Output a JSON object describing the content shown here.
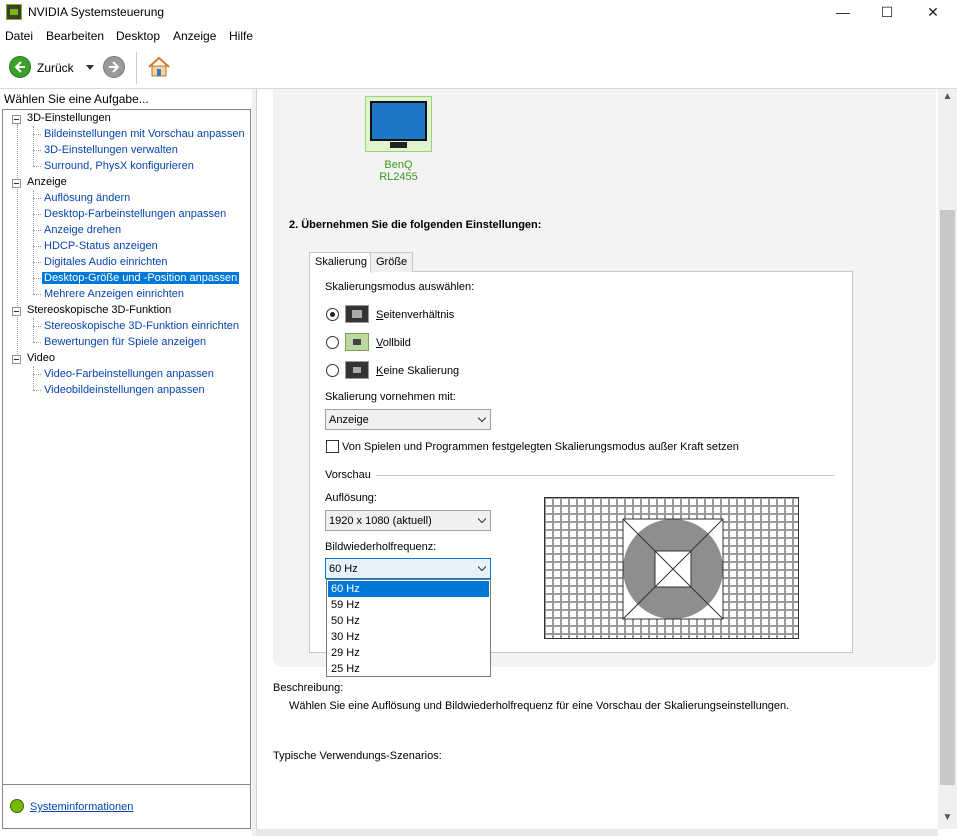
{
  "window": {
    "title": "NVIDIA Systemsteuerung",
    "minimize": "—",
    "maximize": "☐",
    "close": "✕"
  },
  "menu": [
    "Datei",
    "Bearbeiten",
    "Desktop",
    "Anzeige",
    "Hilfe"
  ],
  "toolbar": {
    "back_label": "Zurück"
  },
  "sidebar": {
    "header": "Wählen Sie eine Aufgabe...",
    "groups": [
      {
        "label": "3D-Einstellungen",
        "items": [
          "Bildeinstellungen mit Vorschau anpassen",
          "3D-Einstellungen verwalten",
          "Surround, PhysX konfigurieren"
        ]
      },
      {
        "label": "Anzeige",
        "items": [
          "Auflösung ändern",
          "Desktop-Farbeinstellungen anpassen",
          "Anzeige drehen",
          "HDCP-Status anzeigen",
          "Digitales Audio einrichten",
          "Desktop-Größe und -Position anpassen",
          "Mehrere Anzeigen einrichten"
        ]
      },
      {
        "label": "Stereoskopische 3D-Funktion",
        "items": [
          "Stereoskopische 3D-Funktion einrichten",
          "Bewertungen für Spiele anzeigen"
        ]
      },
      {
        "label": "Video",
        "items": [
          "Video-Farbeinstellungen anpassen",
          "Videobildeinstellungen anpassen"
        ]
      }
    ],
    "selected_item": "Desktop-Größe und -Position anpassen",
    "sysinfo": "Systeminformationen"
  },
  "main": {
    "monitor_label": "BenQ RL2455",
    "step2_title": "2. Übernehmen Sie die folgenden Einstellungen:",
    "tabs": [
      "Skalierung",
      "Größe"
    ],
    "active_tab": "Skalierung",
    "scaling_mode_label": "Skalierungsmodus auswählen:",
    "modes": [
      {
        "accel": "S",
        "rest": "eitenverhältnis",
        "selected": true
      },
      {
        "accel": "V",
        "rest": "ollbild",
        "selected": false
      },
      {
        "accel": "K",
        "rest": "eine Skalierung",
        "selected": false
      }
    ],
    "perform_label": "Skalierung vornehmen mit:",
    "perform_value": "Anzeige",
    "override_label": "Von Spielen und Programmen festgelegten Skalierungsmodus außer Kraft setzen",
    "override_checked": false,
    "preview_label": "Vorschau",
    "resolution_label": "Auflösung:",
    "resolution_value": "1920 x 1080 (aktuell)",
    "refresh_label": "Bildwiederholfrequenz:",
    "refresh_value": "60 Hz",
    "refresh_options": [
      "60 Hz",
      "59 Hz",
      "50 Hz",
      "30 Hz",
      "29 Hz",
      "25 Hz"
    ],
    "refresh_selected_index": 0,
    "description_label": "Beschreibung:",
    "description_text": "Wählen Sie eine Auflösung und Bildwiederholfrequenz für eine Vorschau der Skalierungseinstellungen.",
    "usage_label": "Typische Verwendungs-Szenarios:"
  },
  "colors": {
    "accent": "#0078d7",
    "nvidia_green": "#76b900",
    "link": "#0645ad"
  }
}
